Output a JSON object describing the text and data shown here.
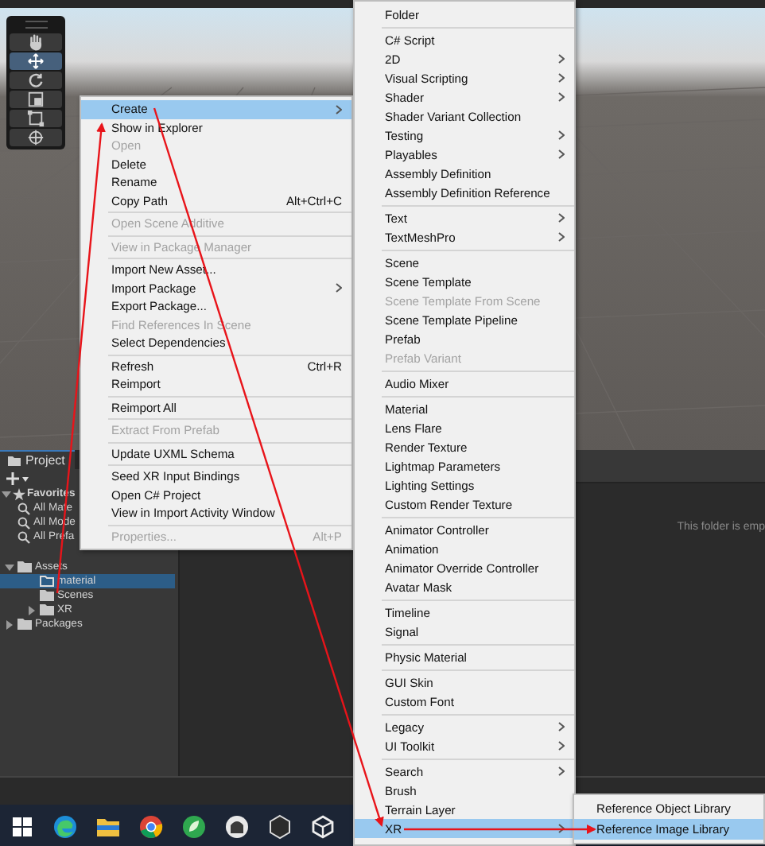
{
  "scene_tools": [
    {
      "kind": "hand",
      "selected": false
    },
    {
      "kind": "move",
      "selected": true
    },
    {
      "kind": "rotate",
      "selected": false
    },
    {
      "kind": "scale",
      "selected": false
    },
    {
      "kind": "rect",
      "selected": false
    },
    {
      "kind": "transform",
      "selected": false
    }
  ],
  "project_panel": {
    "tab": {
      "label": "Project",
      "selected": true
    },
    "favorites": {
      "label": "Favorites",
      "expanded": true,
      "items": [
        {
          "label": "All Mate"
        },
        {
          "label": "All Mode"
        },
        {
          "label": "All Prefa"
        }
      ]
    },
    "tree": [
      {
        "label": "Assets",
        "expanded": true,
        "selected": false,
        "children": [
          {
            "label": "material",
            "selected": true
          },
          {
            "label": "Scenes",
            "selected": false
          },
          {
            "label": "XR",
            "expanded": false,
            "selected": false
          }
        ]
      },
      {
        "label": "Packages",
        "expanded": false,
        "selected": false
      }
    ],
    "empty_message": "This folder is emp"
  },
  "context_menu": [
    [
      {
        "label": "Create",
        "selected": true,
        "disabled": false,
        "submenu": true
      },
      {
        "label": "Show in Explorer",
        "selected": false,
        "disabled": false,
        "submenu": false
      },
      {
        "label": "Open",
        "selected": false,
        "disabled": true,
        "submenu": false
      },
      {
        "label": "Delete",
        "selected": false,
        "disabled": false,
        "submenu": false
      },
      {
        "label": "Rename",
        "selected": false,
        "disabled": false,
        "submenu": false
      },
      {
        "label": "Copy Path",
        "shortcut": "Alt+Ctrl+C",
        "selected": false,
        "disabled": false,
        "submenu": false
      }
    ],
    [
      {
        "label": "Open Scene Additive",
        "selected": false,
        "disabled": true,
        "submenu": false
      }
    ],
    [
      {
        "label": "View in Package Manager",
        "selected": false,
        "disabled": true,
        "submenu": false
      }
    ],
    [
      {
        "label": "Import New Asset...",
        "selected": false,
        "disabled": false,
        "submenu": false
      },
      {
        "label": "Import Package",
        "selected": false,
        "disabled": false,
        "submenu": true
      },
      {
        "label": "Export Package...",
        "selected": false,
        "disabled": false,
        "submenu": false
      },
      {
        "label": "Find References In Scene",
        "selected": false,
        "disabled": true,
        "submenu": false
      },
      {
        "label": "Select Dependencies",
        "selected": false,
        "disabled": false,
        "submenu": false
      }
    ],
    [
      {
        "label": "Refresh",
        "shortcut": "Ctrl+R",
        "selected": false,
        "disabled": false,
        "submenu": false
      },
      {
        "label": "Reimport",
        "selected": false,
        "disabled": false,
        "submenu": false
      }
    ],
    [
      {
        "label": "Reimport All",
        "selected": false,
        "disabled": false,
        "submenu": false
      }
    ],
    [
      {
        "label": "Extract From Prefab",
        "selected": false,
        "disabled": true,
        "submenu": false
      }
    ],
    [
      {
        "label": "Update UXML Schema",
        "selected": false,
        "disabled": false,
        "submenu": false
      }
    ],
    [
      {
        "label": "Seed XR Input Bindings",
        "selected": false,
        "disabled": false,
        "submenu": false
      },
      {
        "label": "Open C# Project",
        "selected": false,
        "disabled": false,
        "submenu": false
      },
      {
        "label": "View in Import Activity Window",
        "selected": false,
        "disabled": false,
        "submenu": false
      }
    ],
    [
      {
        "label": "Properties...",
        "shortcut": "Alt+P",
        "selected": false,
        "disabled": true,
        "submenu": false
      }
    ]
  ],
  "create_menu": [
    [
      {
        "label": "Folder",
        "selected": false,
        "disabled": false,
        "submenu": false
      }
    ],
    [
      {
        "label": "C# Script",
        "selected": false,
        "disabled": false,
        "submenu": false
      },
      {
        "label": "2D",
        "selected": false,
        "disabled": false,
        "submenu": true
      },
      {
        "label": "Visual Scripting",
        "selected": false,
        "disabled": false,
        "submenu": true
      },
      {
        "label": "Shader",
        "selected": false,
        "disabled": false,
        "submenu": true
      },
      {
        "label": "Shader Variant Collection",
        "selected": false,
        "disabled": false,
        "submenu": false
      },
      {
        "label": "Testing",
        "selected": false,
        "disabled": false,
        "submenu": true
      },
      {
        "label": "Playables",
        "selected": false,
        "disabled": false,
        "submenu": true
      },
      {
        "label": "Assembly Definition",
        "selected": false,
        "disabled": false,
        "submenu": false
      },
      {
        "label": "Assembly Definition Reference",
        "selected": false,
        "disabled": false,
        "submenu": false
      }
    ],
    [
      {
        "label": "Text",
        "selected": false,
        "disabled": false,
        "submenu": true
      },
      {
        "label": "TextMeshPro",
        "selected": false,
        "disabled": false,
        "submenu": true
      }
    ],
    [
      {
        "label": "Scene",
        "selected": false,
        "disabled": false,
        "submenu": false
      },
      {
        "label": "Scene Template",
        "selected": false,
        "disabled": false,
        "submenu": false
      },
      {
        "label": "Scene Template From Scene",
        "selected": false,
        "disabled": true,
        "submenu": false
      },
      {
        "label": "Scene Template Pipeline",
        "selected": false,
        "disabled": false,
        "submenu": false
      },
      {
        "label": "Prefab",
        "selected": false,
        "disabled": false,
        "submenu": false
      },
      {
        "label": "Prefab Variant",
        "selected": false,
        "disabled": true,
        "submenu": false
      }
    ],
    [
      {
        "label": "Audio Mixer",
        "selected": false,
        "disabled": false,
        "submenu": false
      }
    ],
    [
      {
        "label": "Material",
        "selected": false,
        "disabled": false,
        "submenu": false
      },
      {
        "label": "Lens Flare",
        "selected": false,
        "disabled": false,
        "submenu": false
      },
      {
        "label": "Render Texture",
        "selected": false,
        "disabled": false,
        "submenu": false
      },
      {
        "label": "Lightmap Parameters",
        "selected": false,
        "disabled": false,
        "submenu": false
      },
      {
        "label": "Lighting Settings",
        "selected": false,
        "disabled": false,
        "submenu": false
      },
      {
        "label": "Custom Render Texture",
        "selected": false,
        "disabled": false,
        "submenu": false
      }
    ],
    [
      {
        "label": "Animator Controller",
        "selected": false,
        "disabled": false,
        "submenu": false
      },
      {
        "label": "Animation",
        "selected": false,
        "disabled": false,
        "submenu": false
      },
      {
        "label": "Animator Override Controller",
        "selected": false,
        "disabled": false,
        "submenu": false
      },
      {
        "label": "Avatar Mask",
        "selected": false,
        "disabled": false,
        "submenu": false
      }
    ],
    [
      {
        "label": "Timeline",
        "selected": false,
        "disabled": false,
        "submenu": false
      },
      {
        "label": "Signal",
        "selected": false,
        "disabled": false,
        "submenu": false
      }
    ],
    [
      {
        "label": "Physic Material",
        "selected": false,
        "disabled": false,
        "submenu": false
      }
    ],
    [
      {
        "label": "GUI Skin",
        "selected": false,
        "disabled": false,
        "submenu": false
      },
      {
        "label": "Custom Font",
        "selected": false,
        "disabled": false,
        "submenu": false
      }
    ],
    [
      {
        "label": "Legacy",
        "selected": false,
        "disabled": false,
        "submenu": true
      },
      {
        "label": "UI Toolkit",
        "selected": false,
        "disabled": false,
        "submenu": true
      }
    ],
    [
      {
        "label": "Search",
        "selected": false,
        "disabled": false,
        "submenu": true
      },
      {
        "label": "Brush",
        "selected": false,
        "disabled": false,
        "submenu": false
      },
      {
        "label": "Terrain Layer",
        "selected": false,
        "disabled": false,
        "submenu": false
      },
      {
        "label": "XR",
        "selected": true,
        "disabled": false,
        "submenu": true
      }
    ]
  ],
  "xr_menu": [
    [
      {
        "label": "Reference Object Library",
        "selected": false,
        "disabled": false,
        "submenu": false
      },
      {
        "label": "Reference Image Library",
        "selected": true,
        "disabled": false,
        "submenu": false
      }
    ]
  ],
  "taskbar": [
    {
      "kind": "windows"
    },
    {
      "kind": "edge"
    },
    {
      "kind": "explorer"
    },
    {
      "kind": "chrome"
    },
    {
      "kind": "leaf"
    },
    {
      "kind": "ghost"
    },
    {
      "kind": "hexagon"
    },
    {
      "kind": "unity"
    }
  ]
}
